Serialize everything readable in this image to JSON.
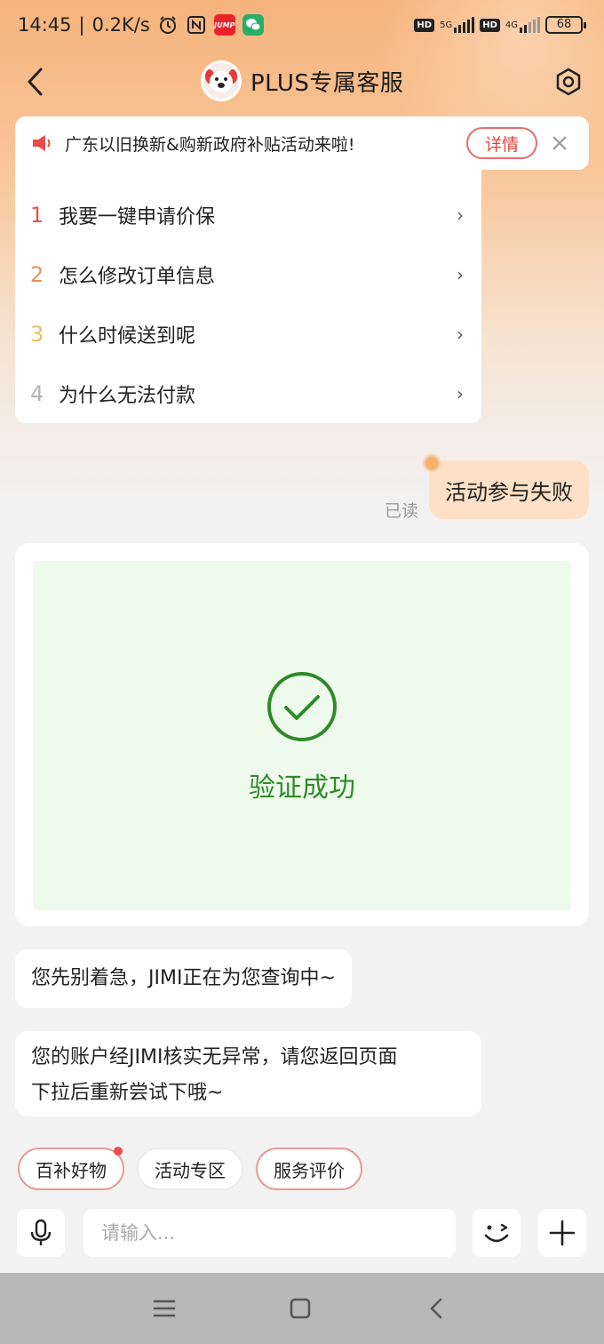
{
  "status_bar": {
    "time": "14:45",
    "speed": "0.2K/s",
    "net1": "5G",
    "net2": "4G",
    "battery": "68",
    "jump_label": "JUMP"
  },
  "header": {
    "title": "PLUS专属客服"
  },
  "notice": {
    "text": "广东以旧换新&购新政府补贴活动来啦!",
    "detail_label": "详情"
  },
  "faq": {
    "items": [
      {
        "num": "1",
        "label": "我要一键申请价保",
        "color": "#e5534b"
      },
      {
        "num": "2",
        "label": "怎么修改订单信息",
        "color": "#e9935a"
      },
      {
        "num": "3",
        "label": "什么时候送到呢",
        "color": "#e6c262"
      },
      {
        "num": "4",
        "label": "为什么无法付款",
        "color": "#b5b5b5"
      }
    ],
    "arrow": "›"
  },
  "conversation": {
    "user_message": "活动参与失败",
    "read_status": "已读",
    "verify_text": "验证成功",
    "bot_message_1": "您先别着急，JIMI正在为您查询中~",
    "bot_message_2_line1": "您的账户经JIMI核实无异常，请您返回页面",
    "bot_message_2_line2": "下拉后重新尝试下哦~"
  },
  "quick_actions": [
    {
      "label": "百补好物"
    },
    {
      "label": "活动专区"
    },
    {
      "label": "服务评价"
    }
  ],
  "input": {
    "placeholder": "请输入..."
  },
  "colors": {
    "accent_red": "#e0443f",
    "success_green": "#2f8a2a",
    "user_bubble": "#fde0c5"
  }
}
